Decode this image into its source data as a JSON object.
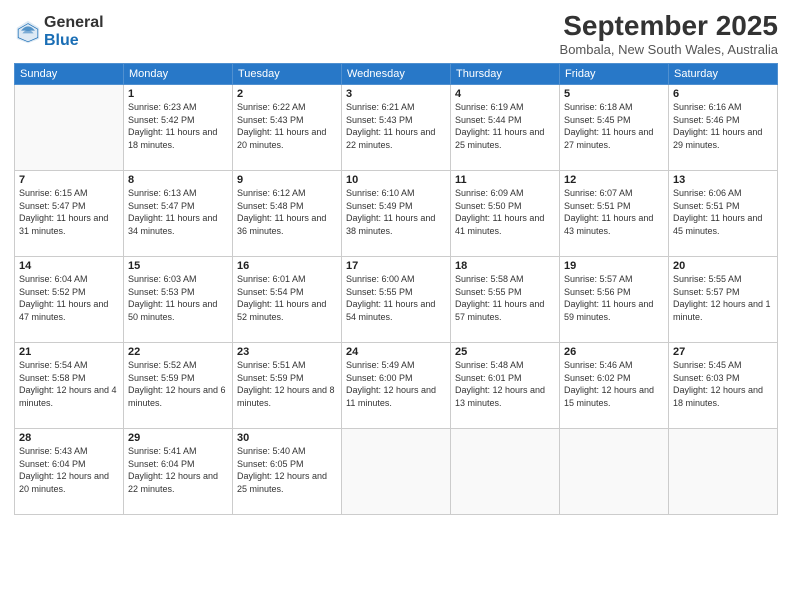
{
  "logo": {
    "general": "General",
    "blue": "Blue"
  },
  "title": "September 2025",
  "location": "Bombala, New South Wales, Australia",
  "days_header": [
    "Sunday",
    "Monday",
    "Tuesday",
    "Wednesday",
    "Thursday",
    "Friday",
    "Saturday"
  ],
  "weeks": [
    [
      {
        "day": "",
        "sunrise": "",
        "sunset": "",
        "daylight": ""
      },
      {
        "day": "1",
        "sunrise": "Sunrise: 6:23 AM",
        "sunset": "Sunset: 5:42 PM",
        "daylight": "Daylight: 11 hours and 18 minutes."
      },
      {
        "day": "2",
        "sunrise": "Sunrise: 6:22 AM",
        "sunset": "Sunset: 5:43 PM",
        "daylight": "Daylight: 11 hours and 20 minutes."
      },
      {
        "day": "3",
        "sunrise": "Sunrise: 6:21 AM",
        "sunset": "Sunset: 5:43 PM",
        "daylight": "Daylight: 11 hours and 22 minutes."
      },
      {
        "day": "4",
        "sunrise": "Sunrise: 6:19 AM",
        "sunset": "Sunset: 5:44 PM",
        "daylight": "Daylight: 11 hours and 25 minutes."
      },
      {
        "day": "5",
        "sunrise": "Sunrise: 6:18 AM",
        "sunset": "Sunset: 5:45 PM",
        "daylight": "Daylight: 11 hours and 27 minutes."
      },
      {
        "day": "6",
        "sunrise": "Sunrise: 6:16 AM",
        "sunset": "Sunset: 5:46 PM",
        "daylight": "Daylight: 11 hours and 29 minutes."
      }
    ],
    [
      {
        "day": "7",
        "sunrise": "Sunrise: 6:15 AM",
        "sunset": "Sunset: 5:47 PM",
        "daylight": "Daylight: 11 hours and 31 minutes."
      },
      {
        "day": "8",
        "sunrise": "Sunrise: 6:13 AM",
        "sunset": "Sunset: 5:47 PM",
        "daylight": "Daylight: 11 hours and 34 minutes."
      },
      {
        "day": "9",
        "sunrise": "Sunrise: 6:12 AM",
        "sunset": "Sunset: 5:48 PM",
        "daylight": "Daylight: 11 hours and 36 minutes."
      },
      {
        "day": "10",
        "sunrise": "Sunrise: 6:10 AM",
        "sunset": "Sunset: 5:49 PM",
        "daylight": "Daylight: 11 hours and 38 minutes."
      },
      {
        "day": "11",
        "sunrise": "Sunrise: 6:09 AM",
        "sunset": "Sunset: 5:50 PM",
        "daylight": "Daylight: 11 hours and 41 minutes."
      },
      {
        "day": "12",
        "sunrise": "Sunrise: 6:07 AM",
        "sunset": "Sunset: 5:51 PM",
        "daylight": "Daylight: 11 hours and 43 minutes."
      },
      {
        "day": "13",
        "sunrise": "Sunrise: 6:06 AM",
        "sunset": "Sunset: 5:51 PM",
        "daylight": "Daylight: 11 hours and 45 minutes."
      }
    ],
    [
      {
        "day": "14",
        "sunrise": "Sunrise: 6:04 AM",
        "sunset": "Sunset: 5:52 PM",
        "daylight": "Daylight: 11 hours and 47 minutes."
      },
      {
        "day": "15",
        "sunrise": "Sunrise: 6:03 AM",
        "sunset": "Sunset: 5:53 PM",
        "daylight": "Daylight: 11 hours and 50 minutes."
      },
      {
        "day": "16",
        "sunrise": "Sunrise: 6:01 AM",
        "sunset": "Sunset: 5:54 PM",
        "daylight": "Daylight: 11 hours and 52 minutes."
      },
      {
        "day": "17",
        "sunrise": "Sunrise: 6:00 AM",
        "sunset": "Sunset: 5:55 PM",
        "daylight": "Daylight: 11 hours and 54 minutes."
      },
      {
        "day": "18",
        "sunrise": "Sunrise: 5:58 AM",
        "sunset": "Sunset: 5:55 PM",
        "daylight": "Daylight: 11 hours and 57 minutes."
      },
      {
        "day": "19",
        "sunrise": "Sunrise: 5:57 AM",
        "sunset": "Sunset: 5:56 PM",
        "daylight": "Daylight: 11 hours and 59 minutes."
      },
      {
        "day": "20",
        "sunrise": "Sunrise: 5:55 AM",
        "sunset": "Sunset: 5:57 PM",
        "daylight": "Daylight: 12 hours and 1 minute."
      }
    ],
    [
      {
        "day": "21",
        "sunrise": "Sunrise: 5:54 AM",
        "sunset": "Sunset: 5:58 PM",
        "daylight": "Daylight: 12 hours and 4 minutes."
      },
      {
        "day": "22",
        "sunrise": "Sunrise: 5:52 AM",
        "sunset": "Sunset: 5:59 PM",
        "daylight": "Daylight: 12 hours and 6 minutes."
      },
      {
        "day": "23",
        "sunrise": "Sunrise: 5:51 AM",
        "sunset": "Sunset: 5:59 PM",
        "daylight": "Daylight: 12 hours and 8 minutes."
      },
      {
        "day": "24",
        "sunrise": "Sunrise: 5:49 AM",
        "sunset": "Sunset: 6:00 PM",
        "daylight": "Daylight: 12 hours and 11 minutes."
      },
      {
        "day": "25",
        "sunrise": "Sunrise: 5:48 AM",
        "sunset": "Sunset: 6:01 PM",
        "daylight": "Daylight: 12 hours and 13 minutes."
      },
      {
        "day": "26",
        "sunrise": "Sunrise: 5:46 AM",
        "sunset": "Sunset: 6:02 PM",
        "daylight": "Daylight: 12 hours and 15 minutes."
      },
      {
        "day": "27",
        "sunrise": "Sunrise: 5:45 AM",
        "sunset": "Sunset: 6:03 PM",
        "daylight": "Daylight: 12 hours and 18 minutes."
      }
    ],
    [
      {
        "day": "28",
        "sunrise": "Sunrise: 5:43 AM",
        "sunset": "Sunset: 6:04 PM",
        "daylight": "Daylight: 12 hours and 20 minutes."
      },
      {
        "day": "29",
        "sunrise": "Sunrise: 5:41 AM",
        "sunset": "Sunset: 6:04 PM",
        "daylight": "Daylight: 12 hours and 22 minutes."
      },
      {
        "day": "30",
        "sunrise": "Sunrise: 5:40 AM",
        "sunset": "Sunset: 6:05 PM",
        "daylight": "Daylight: 12 hours and 25 minutes."
      },
      {
        "day": "",
        "sunrise": "",
        "sunset": "",
        "daylight": ""
      },
      {
        "day": "",
        "sunrise": "",
        "sunset": "",
        "daylight": ""
      },
      {
        "day": "",
        "sunrise": "",
        "sunset": "",
        "daylight": ""
      },
      {
        "day": "",
        "sunrise": "",
        "sunset": "",
        "daylight": ""
      }
    ]
  ]
}
